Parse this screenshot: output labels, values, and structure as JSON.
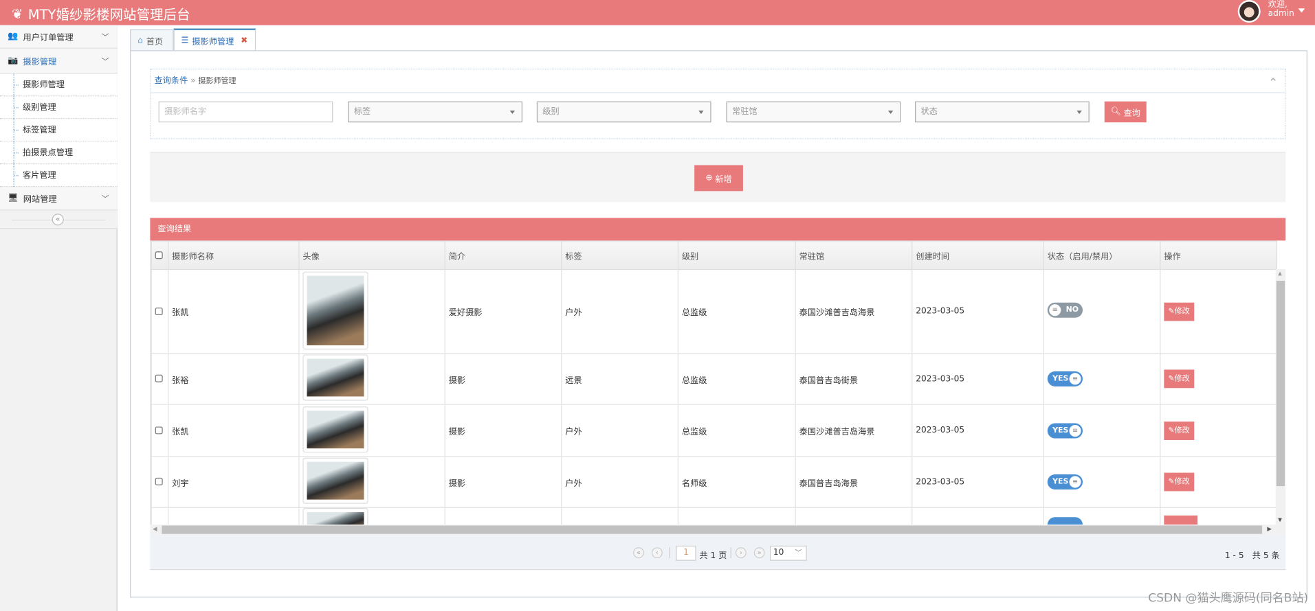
{
  "header": {
    "title": "MTY婚纱影楼网站管理后台",
    "welcome": "欢迎,",
    "user": "admin"
  },
  "sidebar": {
    "groups": [
      {
        "label": "用户订单管理"
      },
      {
        "label": "摄影管理",
        "items": [
          "摄影师管理",
          "级别管理",
          "标签管理",
          "拍摄景点管理",
          "客片管理"
        ]
      },
      {
        "label": "网站管理"
      }
    ],
    "collapse": "«"
  },
  "tabs": [
    {
      "label": "首页"
    },
    {
      "label": "摄影师管理",
      "close": "✖"
    }
  ],
  "query": {
    "title": "查询条件",
    "sep": "»",
    "crumb": "摄影师管理",
    "name_placeholder": "摄影师名字",
    "tag": "标签",
    "level": "级别",
    "studio": "常驻馆",
    "status": "状态",
    "search": "查询",
    "collapse": "⌃"
  },
  "add_label": "新增",
  "results": {
    "title": "查询结果",
    "columns": [
      "摄影师名称",
      "头像",
      "简介",
      "标签",
      "级别",
      "常驻馆",
      "创建时间",
      "状态（启用/禁用）",
      "操作"
    ],
    "rows": [
      {
        "name": "张凯",
        "intro": "爱好摄影",
        "tag": "户外",
        "level": "总监级",
        "studio": "泰国沙滩普吉岛海景",
        "created": "2023-03-05",
        "status": "NO"
      },
      {
        "name": "张裕",
        "intro": "摄影",
        "tag": "远景",
        "level": "总监级",
        "studio": "泰国普吉岛街景",
        "created": "2023-03-05",
        "status": "YES"
      },
      {
        "name": "张凯",
        "intro": "摄影",
        "tag": "户外",
        "level": "总监级",
        "studio": "泰国沙滩普吉岛海景",
        "created": "2023-03-05",
        "status": "YES"
      },
      {
        "name": "刘宇",
        "intro": "摄影",
        "tag": "户外",
        "level": "名师级",
        "studio": "泰国普吉岛海景",
        "created": "2023-03-05",
        "status": "YES"
      }
    ],
    "edit_label": "修改"
  },
  "pager": {
    "page": "1",
    "total_pages": "共 1 页",
    "page_size": "10",
    "summary": "1 - 5　共 5 条"
  },
  "watermark": "CSDN @猫头鹰源码(同名B站)"
}
